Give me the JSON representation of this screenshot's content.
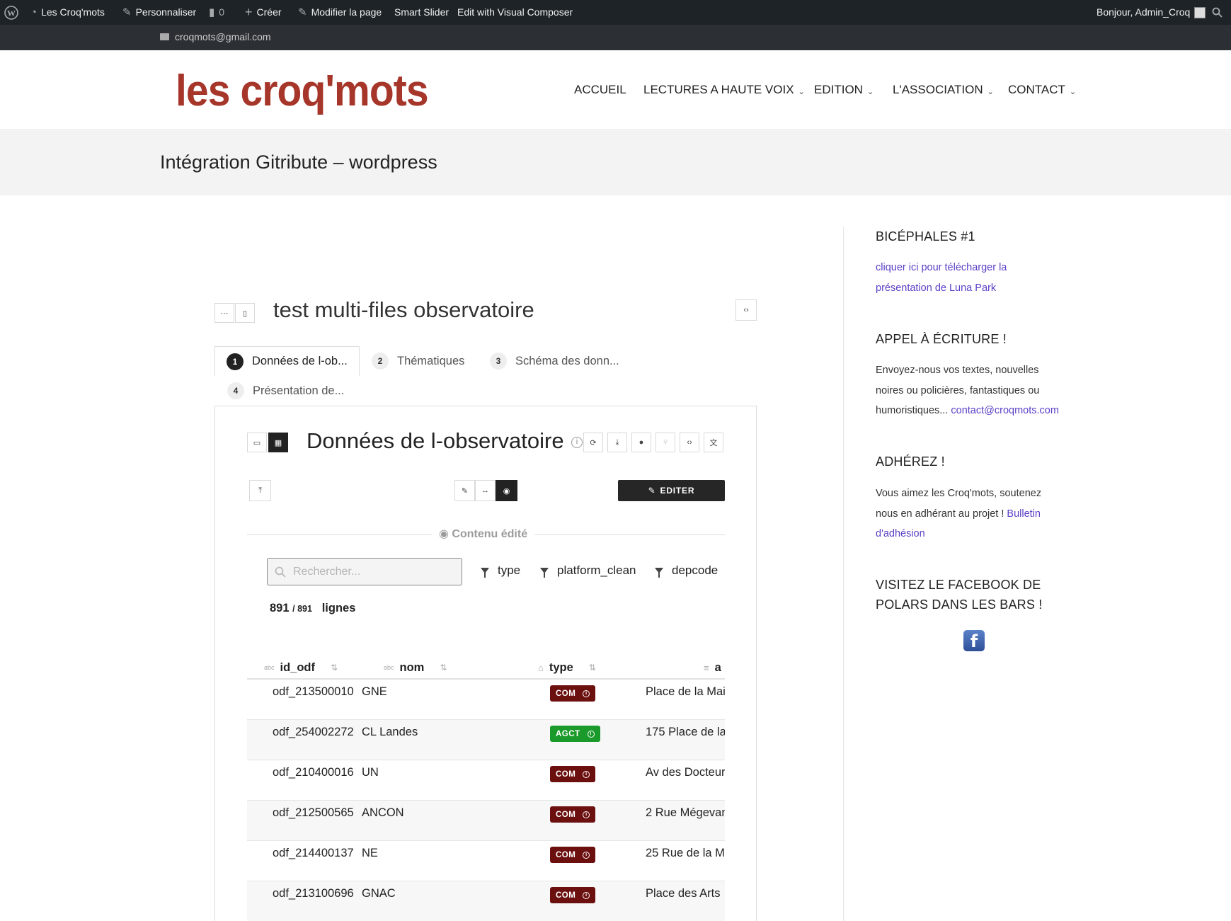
{
  "admin_bar": {
    "site_name": "Les Croq'mots",
    "customize": "Personnaliser",
    "comments_count": "0",
    "create": "Créer",
    "edit_page": "Modifier la page",
    "smart_slider": "Smart Slider",
    "visual_composer": "Edit with Visual Composer",
    "greeting": "Bonjour, Admin_Croq"
  },
  "topbar": {
    "email": "croqmots@gmail.com"
  },
  "header": {
    "logo_text": "les croq'mots",
    "nav": [
      {
        "label": "ACCUEIL",
        "has_dropdown": false
      },
      {
        "label": "LECTURES A HAUTE VOIX",
        "has_dropdown": true
      },
      {
        "label": "EDITION",
        "has_dropdown": true
      },
      {
        "label": "L'ASSOCIATION",
        "has_dropdown": true
      },
      {
        "label": "CONTACT",
        "has_dropdown": true
      }
    ]
  },
  "page": {
    "title": "Intégration Gitribute – wordpress"
  },
  "widget": {
    "title": "test multi-files observatoire",
    "tabs": [
      {
        "num": "1",
        "label": "Données de l-ob..."
      },
      {
        "num": "2",
        "label": "Thématiques"
      },
      {
        "num": "3",
        "label": "Schéma des donn..."
      },
      {
        "num": "4",
        "label": "Présentation de..."
      }
    ],
    "dataset_title": "Données de l-observatoire",
    "edit_button": "EDITER",
    "content_label": "Contenu édité",
    "search_placeholder": "Rechercher...",
    "filters": [
      "type",
      "platform_clean",
      "depcode"
    ],
    "count": {
      "shown": "891",
      "total": "891",
      "label": "lignes"
    },
    "columns": [
      {
        "type_icon": "abc",
        "label": "id_odf"
      },
      {
        "type_icon": "abc",
        "label": "nom"
      },
      {
        "type_icon": "tag",
        "label": "type"
      },
      {
        "type_icon": "text",
        "label": "a"
      }
    ],
    "rows": [
      {
        "id_odf": "odf_213500010",
        "nom": "GNE",
        "type": "COM",
        "adresse": "Place de la Mai"
      },
      {
        "id_odf": "odf_254002272",
        "nom": "CL Landes",
        "type": "AGCT",
        "adresse": "175 Place de la"
      },
      {
        "id_odf": "odf_210400016",
        "nom": "UN",
        "type": "COM",
        "adresse": "Av des Docteur"
      },
      {
        "id_odf": "odf_212500565",
        "nom": "ANCON",
        "type": "COM",
        "adresse": "2 Rue Mégevan"
      },
      {
        "id_odf": "odf_214400137",
        "nom": "NE",
        "type": "COM",
        "adresse": "25 Rue de la Ma"
      },
      {
        "id_odf": "odf_213100696",
        "nom": "GNAC",
        "type": "COM",
        "adresse": "Place des Arts"
      }
    ],
    "badge_colors": {
      "COM": "#6b0f0f",
      "AGCT": "#1a9a2a"
    }
  },
  "sidebar": {
    "sections": [
      {
        "heading": "BICÉPHALES #1",
        "link_line1": "cliquer ici pour télécharger la",
        "link_line2": "présentation de Luna Park"
      },
      {
        "heading": "APPEL À ÉCRITURE !",
        "line1": "Envoyez-nous vos textes, nouvelles",
        "line2": "noires ou policières, fantastiques ou",
        "line3": "humoristiques...",
        "link": "contact@croqmots.com"
      },
      {
        "heading": "ADHÉREZ !",
        "line1": "Vous aimez les Croq'mots, soutenez",
        "line2": "nous en adhérant au projet !",
        "link_part1": "Bulletin",
        "link_part2": "d'adhésion"
      },
      {
        "heading_line1": "VISITEZ LE FACEBOOK DE",
        "heading_line2": "POLARS DANS LES BARS !",
        "icon": "facebook-icon"
      }
    ]
  },
  "colors": {
    "accent_link": "#5b3fc7",
    "logo": "#a6352a",
    "admin_bar": "#1d2327"
  }
}
